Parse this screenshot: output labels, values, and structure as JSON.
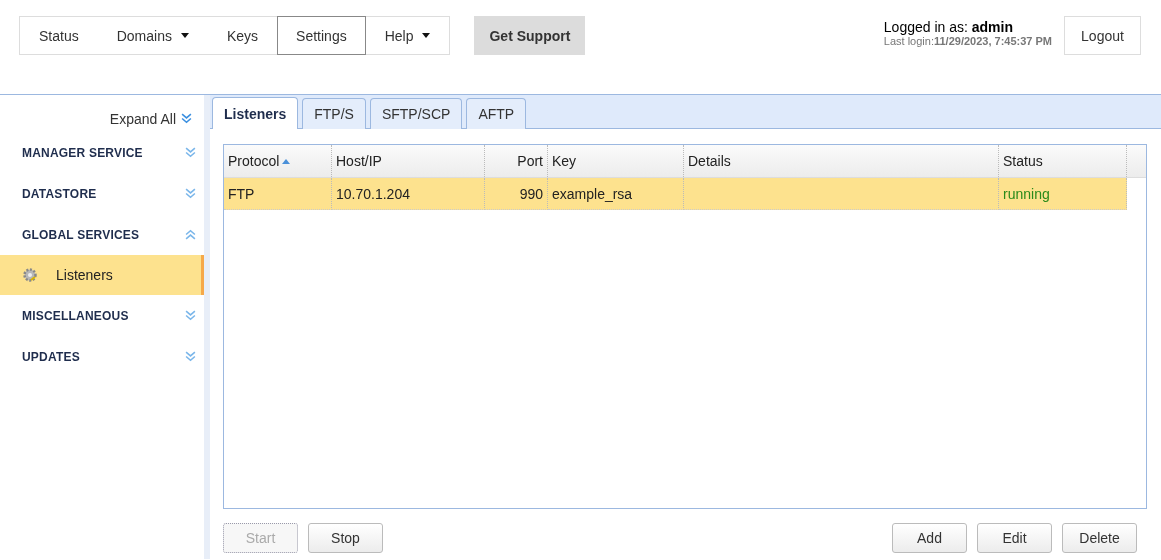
{
  "nav": {
    "items": [
      {
        "label": "Status",
        "dropdown": false,
        "selected": false
      },
      {
        "label": "Domains",
        "dropdown": true,
        "selected": false
      },
      {
        "label": "Keys",
        "dropdown": false,
        "selected": false
      },
      {
        "label": "Settings",
        "dropdown": false,
        "selected": true
      },
      {
        "label": "Help",
        "dropdown": true,
        "selected": false
      }
    ],
    "support_button": "Get Support"
  },
  "user": {
    "logged_in": "Logged in as: **admin**",
    "last_login": "Last login:**11/29/2023, 7:45:37 PM**",
    "logout_button": "Logout"
  },
  "sidebar": {
    "expand_all": "Expand All",
    "sections": [
      {
        "label": "MANAGER SERVICE",
        "expanded": false
      },
      {
        "label": "DATASTORE",
        "expanded": false
      },
      {
        "label": "GLOBAL SERVICES",
        "expanded": true,
        "children": [
          {
            "label": "Listeners",
            "selected": true
          }
        ]
      },
      {
        "label": "MISCELLANEOUS",
        "expanded": false
      },
      {
        "label": "UPDATES",
        "expanded": false
      }
    ]
  },
  "tabs": [
    {
      "label": "Listeners",
      "selected": true
    },
    {
      "label": "FTP/S",
      "selected": false
    },
    {
      "label": "SFTP/SCP",
      "selected": false
    },
    {
      "label": "AFTP",
      "selected": false
    }
  ],
  "table": {
    "columns": [
      {
        "label": "Protocol",
        "sorted": true,
        "numeric": false
      },
      {
        "label": "Host/IP",
        "sorted": false,
        "numeric": false
      },
      {
        "label": "Port",
        "sorted": false,
        "numeric": true
      },
      {
        "label": "Key",
        "sorted": false,
        "numeric": false
      },
      {
        "label": "Details",
        "sorted": false,
        "numeric": false
      },
      {
        "label": "Status",
        "sorted": false,
        "numeric": false
      }
    ],
    "rows": [
      {
        "selected": true,
        "running": true,
        "cells": [
          "FTP",
          "10.70.1.204",
          "990",
          "example_rsa",
          "",
          "running"
        ]
      }
    ]
  },
  "buttons_left": [
    {
      "label": "Start",
      "disabled": true
    },
    {
      "label": "Stop",
      "disabled": false
    }
  ],
  "buttons_right": [
    {
      "label": "Add",
      "disabled": false
    },
    {
      "label": "Edit",
      "disabled": false
    },
    {
      "label": "Delete",
      "disabled": false
    }
  ]
}
